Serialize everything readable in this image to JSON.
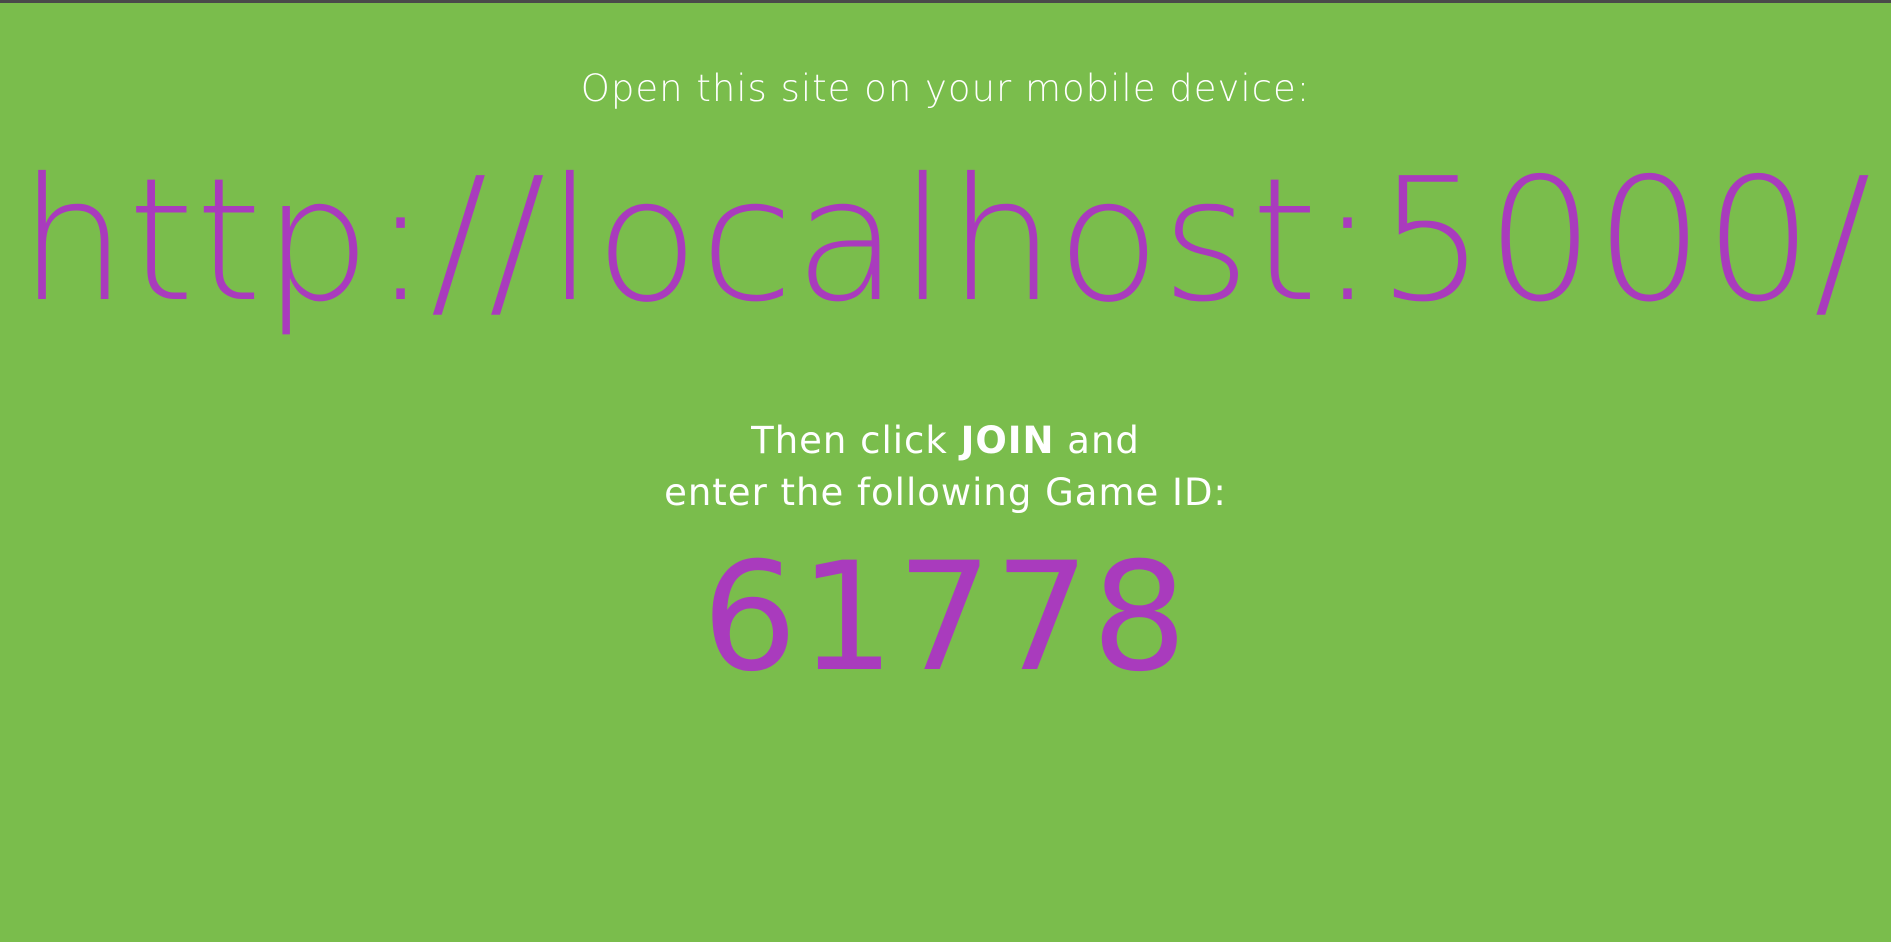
{
  "colors": {
    "background": "#7abd4c",
    "accent": "#a93bbd",
    "text": "#ffffff",
    "top_border": "#4a4a4a"
  },
  "screen": {
    "open_site_prompt": "Open this site on your mobile device:",
    "site_url": "http://localhost:5000/",
    "join_prefix": "Then click ",
    "join_word": "JOIN",
    "join_suffix": " and",
    "enter_id_prompt": "enter the following Game ID:",
    "game_id": "61778"
  }
}
